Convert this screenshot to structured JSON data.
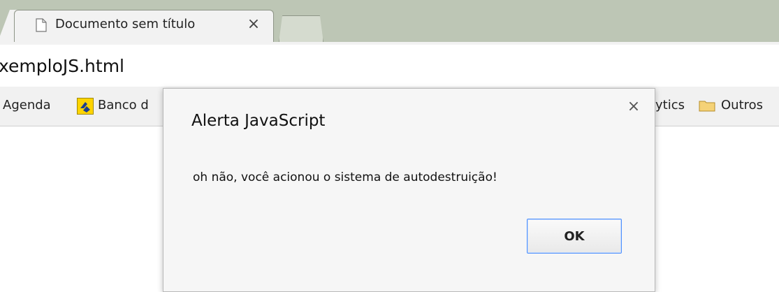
{
  "browser": {
    "tab": {
      "title": "Documento sem título",
      "close": "×",
      "icon": "page-icon"
    },
    "url": "xemploJS.html",
    "bookmarks": [
      {
        "label": "Agenda"
      },
      {
        "label": "Banco d",
        "icon": "banco-do-brasil-icon"
      },
      {
        "label": "ytics"
      },
      {
        "label": "Outros",
        "icon": "folder-icon"
      }
    ]
  },
  "dialog": {
    "title": "Alerta JavaScript",
    "message": "oh não, você acionou o sistema de autodestruição!",
    "close": "×",
    "ok_label": "OK"
  },
  "colors": {
    "tabstrip": "#bdc6b5",
    "focus_border": "#4d90fe",
    "bookmark_bg": "#f1f1f1"
  }
}
